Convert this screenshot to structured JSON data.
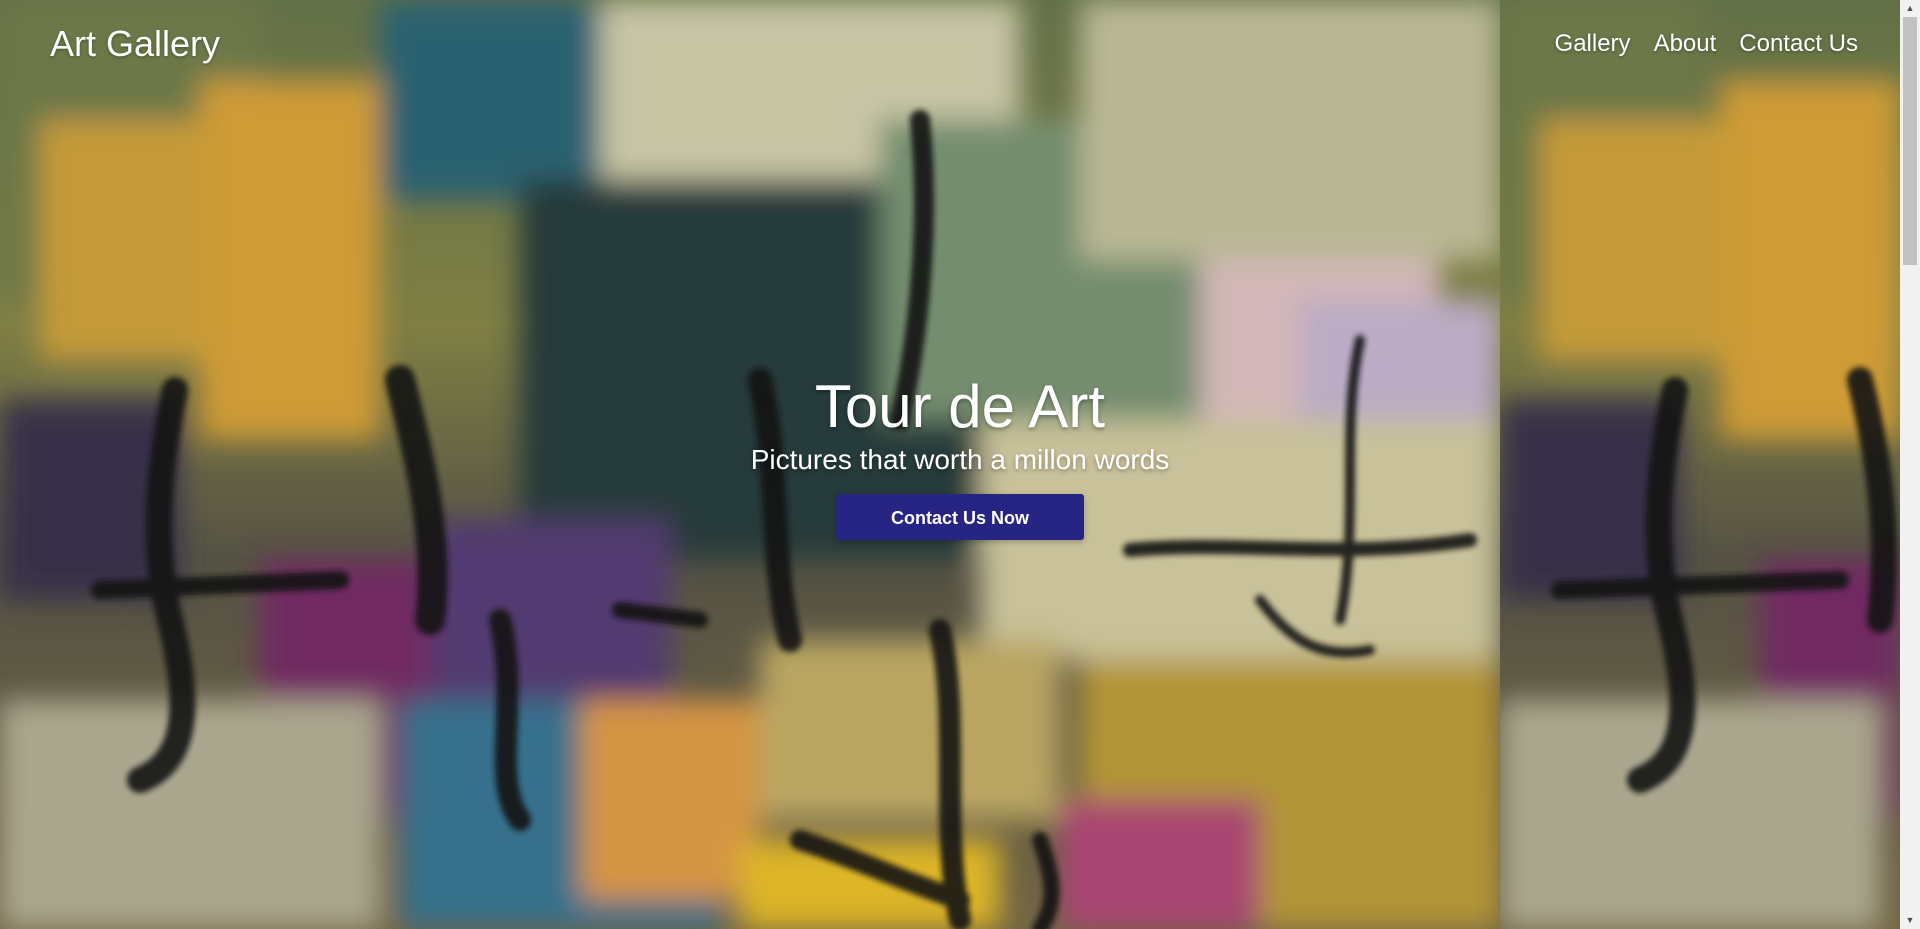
{
  "navbar": {
    "brand": "Art Gallery",
    "links": [
      {
        "label": "Gallery"
      },
      {
        "label": "About"
      },
      {
        "label": "Contact Us"
      }
    ]
  },
  "hero": {
    "title": "Tour de Art",
    "subtitle": "Pictures that worth a millon words",
    "cta_label": "Contact Us Now",
    "background": "abstract-painting",
    "colors": {
      "cta_background": "#262584",
      "text": "#ffffff"
    }
  },
  "scrollbar": {
    "up_icon": "scroll-up-arrow",
    "down_icon": "scroll-down-arrow"
  }
}
